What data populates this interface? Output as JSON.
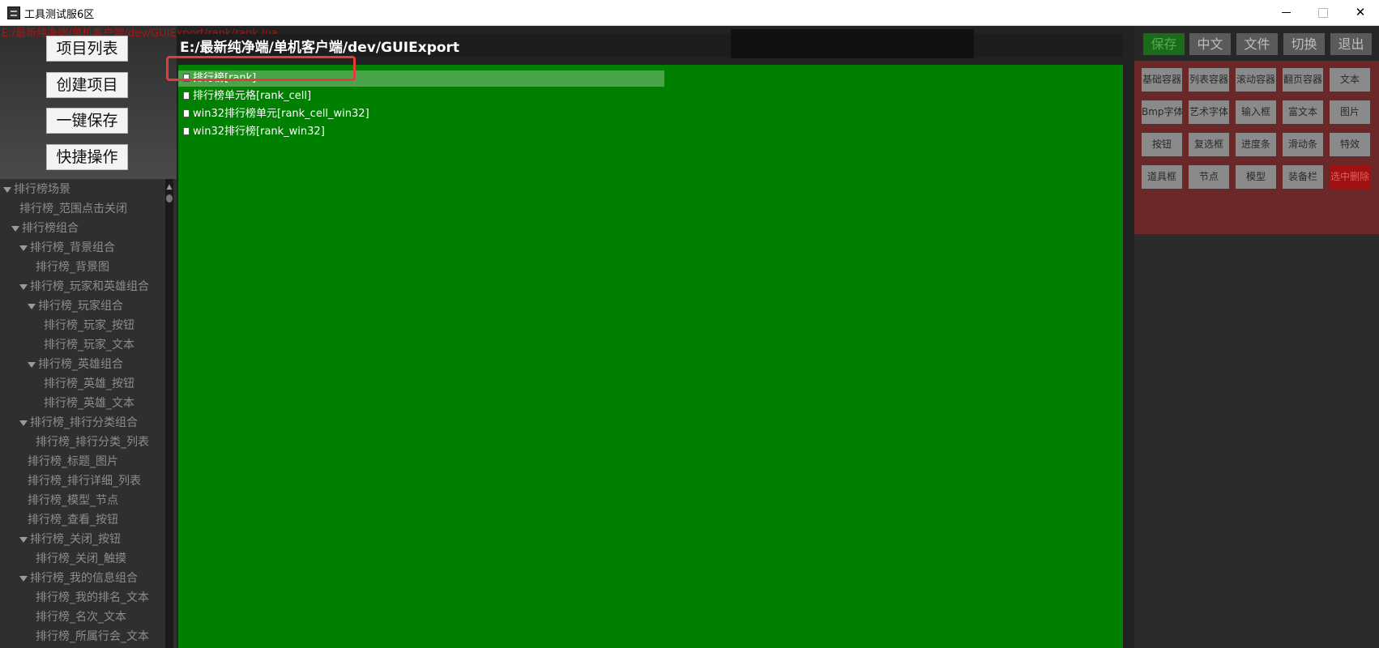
{
  "window": {
    "title": "工具测试服6区",
    "minimize_glyph": "",
    "close_glyph": "✕"
  },
  "overlay_path": "E:/最新纯净端/单机客户端/dev/GUIExport/rank/rank.lua",
  "left_buttons": [
    "项目列表",
    "创建项目",
    "一键保存",
    "快捷操作"
  ],
  "tree": [
    {
      "label": "排行榜场景",
      "depth": 0,
      "expanded": true
    },
    {
      "label": "排行榜_范围点击关闭",
      "depth": 2,
      "expanded": false
    },
    {
      "label": "排行榜组合",
      "depth": 1,
      "expanded": true
    },
    {
      "label": "排行榜_背景组合",
      "depth": 2,
      "expanded": true
    },
    {
      "label": "排行榜_背景图",
      "depth": 4,
      "expanded": false
    },
    {
      "label": "排行榜_玩家和英雄组合",
      "depth": 2,
      "expanded": true
    },
    {
      "label": "排行榜_玩家组合",
      "depth": 3,
      "expanded": true
    },
    {
      "label": "排行榜_玩家_按钮",
      "depth": 5,
      "expanded": false
    },
    {
      "label": "排行榜_玩家_文本",
      "depth": 5,
      "expanded": false
    },
    {
      "label": "排行榜_英雄组合",
      "depth": 3,
      "expanded": true
    },
    {
      "label": "排行榜_英雄_按钮",
      "depth": 5,
      "expanded": false
    },
    {
      "label": "排行榜_英雄_文本",
      "depth": 5,
      "expanded": false
    },
    {
      "label": "排行榜_排行分类组合",
      "depth": 2,
      "expanded": true
    },
    {
      "label": "排行榜_排行分类_列表",
      "depth": 4,
      "expanded": false
    },
    {
      "label": "排行榜_标题_图片",
      "depth": 3,
      "expanded": false
    },
    {
      "label": "排行榜_排行详细_列表",
      "depth": 3,
      "expanded": false
    },
    {
      "label": "排行榜_模型_节点",
      "depth": 3,
      "expanded": false
    },
    {
      "label": "排行榜_查看_按钮",
      "depth": 3,
      "expanded": false
    },
    {
      "label": "排行榜_关闭_按钮",
      "depth": 2,
      "expanded": true
    },
    {
      "label": "排行榜_关闭_触摸",
      "depth": 4,
      "expanded": false
    },
    {
      "label": "排行榜_我的信息组合",
      "depth": 2,
      "expanded": true
    },
    {
      "label": "排行榜_我的排名_文本",
      "depth": 4,
      "expanded": false
    },
    {
      "label": "排行榜_名次_文本",
      "depth": 4,
      "expanded": false
    },
    {
      "label": "排行榜_所属行会_文本",
      "depth": 4,
      "expanded": false
    }
  ],
  "path_bar": "E:/最新纯净端/单机客户端/dev/GUIExport",
  "files": [
    {
      "label": "排行榜[rank]",
      "selected": true
    },
    {
      "label": "排行榜单元格[rank_cell]",
      "selected": false
    },
    {
      "label": "win32排行榜单元[rank_cell_win32]",
      "selected": false
    },
    {
      "label": "win32排行榜[rank_win32]",
      "selected": false
    }
  ],
  "top_buttons": [
    "保存",
    "中文",
    "文件",
    "切换",
    "退出"
  ],
  "widget_buttons": [
    [
      "基础容器",
      "列表容器",
      "滚动容器",
      "翻页容器",
      "文本"
    ],
    [
      "Bmp字体",
      "艺术字体",
      "输入框",
      "富文本",
      "图片"
    ],
    [
      "按钮",
      "复选框",
      "进度条",
      "滑动条",
      "特效"
    ],
    [
      "道具框",
      "节点",
      "模型",
      "装备栏",
      "选中删除"
    ]
  ],
  "colors": {
    "canvas_bg": "#008000",
    "selection": "#4aa54a",
    "highlight_box": "#e83a3a",
    "save_button": "#1a6b1a",
    "delete_button": "#a11111"
  }
}
